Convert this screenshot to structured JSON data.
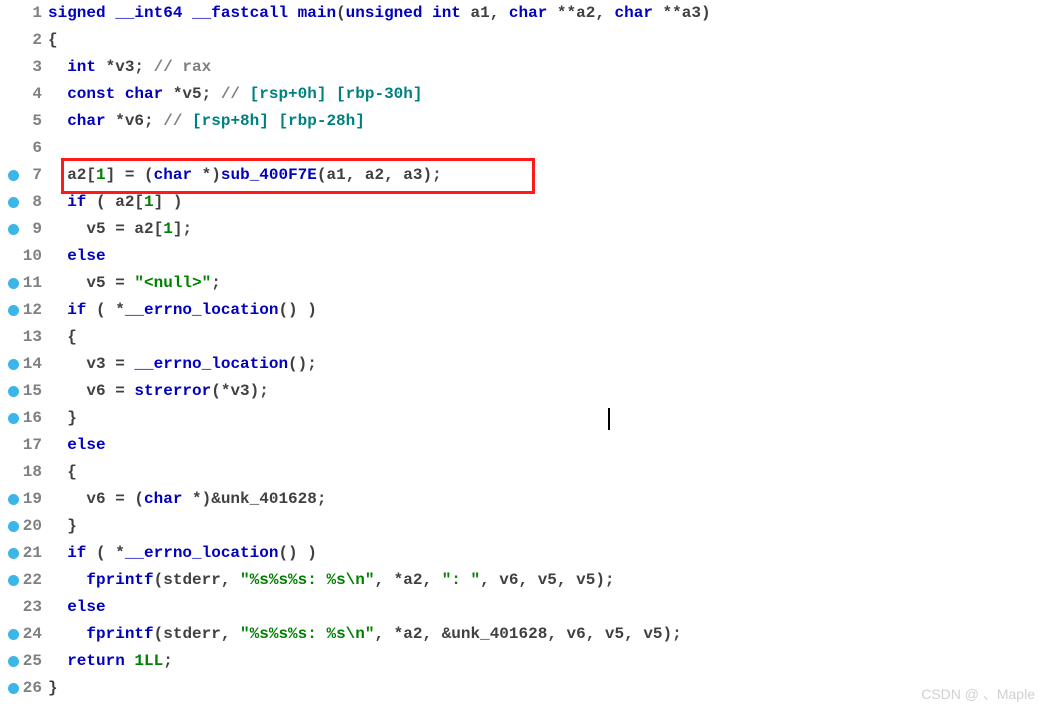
{
  "watermark": "CSDN @ 、Maple",
  "lines": [
    {
      "n": 1,
      "bp": false,
      "tokens": [
        [
          "kw",
          "signed "
        ],
        [
          "kw",
          "__int64 "
        ],
        [
          "type",
          "__fastcall "
        ],
        [
          "func",
          "main"
        ],
        [
          "op",
          "("
        ],
        [
          "kw",
          "unsigned int"
        ],
        [
          "var",
          " a1"
        ],
        [
          "op",
          ", "
        ],
        [
          "kw",
          "char"
        ],
        [
          "op",
          " **"
        ],
        [
          "var",
          "a2"
        ],
        [
          "op",
          ", "
        ],
        [
          "kw",
          "char"
        ],
        [
          "op",
          " **"
        ],
        [
          "var",
          "a3"
        ],
        [
          "op",
          ")"
        ]
      ]
    },
    {
      "n": 2,
      "bp": false,
      "tokens": [
        [
          "op",
          "{"
        ]
      ]
    },
    {
      "n": 3,
      "bp": false,
      "tokens": [
        [
          "txt",
          "  "
        ],
        [
          "kw",
          "int"
        ],
        [
          "op",
          " *"
        ],
        [
          "var",
          "v3"
        ],
        [
          "op",
          "; "
        ],
        [
          "comment",
          "// rax"
        ]
      ]
    },
    {
      "n": 4,
      "bp": false,
      "tokens": [
        [
          "txt",
          "  "
        ],
        [
          "kw",
          "const char"
        ],
        [
          "op",
          " *"
        ],
        [
          "var",
          "v5"
        ],
        [
          "op",
          "; "
        ],
        [
          "comment",
          "// "
        ],
        [
          "comment2",
          "[rsp+0h] [rbp-30h]"
        ]
      ]
    },
    {
      "n": 5,
      "bp": false,
      "tokens": [
        [
          "txt",
          "  "
        ],
        [
          "kw",
          "char"
        ],
        [
          "op",
          " *"
        ],
        [
          "var",
          "v6"
        ],
        [
          "op",
          "; "
        ],
        [
          "comment",
          "// "
        ],
        [
          "comment2",
          "[rsp+8h] [rbp-28h]"
        ]
      ]
    },
    {
      "n": 6,
      "bp": false,
      "tokens": [
        [
          "txt",
          " "
        ]
      ]
    },
    {
      "n": 7,
      "bp": true,
      "tokens": [
        [
          "txt",
          "  "
        ],
        [
          "var",
          "a2"
        ],
        [
          "op",
          "["
        ],
        [
          "num",
          "1"
        ],
        [
          "op",
          "] = ("
        ],
        [
          "kw",
          "char"
        ],
        [
          "op",
          " *)"
        ],
        [
          "func",
          "sub_400F7E"
        ],
        [
          "op",
          "("
        ],
        [
          "var",
          "a1"
        ],
        [
          "op",
          ", "
        ],
        [
          "var",
          "a2"
        ],
        [
          "op",
          ", "
        ],
        [
          "var",
          "a3"
        ],
        [
          "op",
          ");"
        ]
      ]
    },
    {
      "n": 8,
      "bp": true,
      "tokens": [
        [
          "txt",
          "  "
        ],
        [
          "kw",
          "if"
        ],
        [
          "op",
          " ( "
        ],
        [
          "var",
          "a2"
        ],
        [
          "op",
          "["
        ],
        [
          "num",
          "1"
        ],
        [
          "op",
          "] )"
        ]
      ]
    },
    {
      "n": 9,
      "bp": true,
      "tokens": [
        [
          "txt",
          "    "
        ],
        [
          "var",
          "v5"
        ],
        [
          "op",
          " = "
        ],
        [
          "var",
          "a2"
        ],
        [
          "op",
          "["
        ],
        [
          "num",
          "1"
        ],
        [
          "op",
          "];"
        ]
      ]
    },
    {
      "n": 10,
      "bp": false,
      "tokens": [
        [
          "txt",
          "  "
        ],
        [
          "kw",
          "else"
        ]
      ]
    },
    {
      "n": 11,
      "bp": true,
      "tokens": [
        [
          "txt",
          "    "
        ],
        [
          "var",
          "v5"
        ],
        [
          "op",
          " = "
        ],
        [
          "str",
          "\"<null>\""
        ],
        [
          "op",
          ";"
        ]
      ]
    },
    {
      "n": 12,
      "bp": true,
      "tokens": [
        [
          "txt",
          "  "
        ],
        [
          "kw",
          "if"
        ],
        [
          "op",
          " ( *"
        ],
        [
          "func",
          "__errno_location"
        ],
        [
          "op",
          "() )"
        ]
      ]
    },
    {
      "n": 13,
      "bp": false,
      "tokens": [
        [
          "txt",
          "  "
        ],
        [
          "op",
          "{"
        ]
      ]
    },
    {
      "n": 14,
      "bp": true,
      "tokens": [
        [
          "txt",
          "    "
        ],
        [
          "var",
          "v3"
        ],
        [
          "op",
          " = "
        ],
        [
          "func",
          "__errno_location"
        ],
        [
          "op",
          "();"
        ]
      ]
    },
    {
      "n": 15,
      "bp": true,
      "tokens": [
        [
          "txt",
          "    "
        ],
        [
          "var",
          "v6"
        ],
        [
          "op",
          " = "
        ],
        [
          "func",
          "strerror"
        ],
        [
          "op",
          "(*"
        ],
        [
          "var",
          "v3"
        ],
        [
          "op",
          ");"
        ]
      ]
    },
    {
      "n": 16,
      "bp": true,
      "tokens": [
        [
          "txt",
          "  "
        ],
        [
          "op",
          "}"
        ]
      ]
    },
    {
      "n": 17,
      "bp": false,
      "tokens": [
        [
          "txt",
          "  "
        ],
        [
          "kw",
          "else"
        ]
      ]
    },
    {
      "n": 18,
      "bp": false,
      "tokens": [
        [
          "txt",
          "  "
        ],
        [
          "op",
          "{"
        ]
      ]
    },
    {
      "n": 19,
      "bp": true,
      "tokens": [
        [
          "txt",
          "    "
        ],
        [
          "var",
          "v6"
        ],
        [
          "op",
          " = ("
        ],
        [
          "kw",
          "char"
        ],
        [
          "op",
          " *)&"
        ],
        [
          "var",
          "unk_401628"
        ],
        [
          "op",
          ";"
        ]
      ]
    },
    {
      "n": 20,
      "bp": true,
      "tokens": [
        [
          "txt",
          "  "
        ],
        [
          "op",
          "}"
        ]
      ]
    },
    {
      "n": 21,
      "bp": true,
      "tokens": [
        [
          "txt",
          "  "
        ],
        [
          "kw",
          "if"
        ],
        [
          "op",
          " ( *"
        ],
        [
          "func",
          "__errno_location"
        ],
        [
          "op",
          "() )"
        ]
      ]
    },
    {
      "n": 22,
      "bp": true,
      "tokens": [
        [
          "txt",
          "    "
        ],
        [
          "func",
          "fprintf"
        ],
        [
          "op",
          "("
        ],
        [
          "var",
          "stderr"
        ],
        [
          "op",
          ", "
        ],
        [
          "str",
          "\"%s%s%s: %s\\n\""
        ],
        [
          "op",
          ", *"
        ],
        [
          "var",
          "a2"
        ],
        [
          "op",
          ", "
        ],
        [
          "str",
          "\": \""
        ],
        [
          "op",
          ", "
        ],
        [
          "var",
          "v6"
        ],
        [
          "op",
          ", "
        ],
        [
          "var",
          "v5"
        ],
        [
          "op",
          ", "
        ],
        [
          "var",
          "v5"
        ],
        [
          "op",
          ");"
        ]
      ]
    },
    {
      "n": 23,
      "bp": false,
      "tokens": [
        [
          "txt",
          "  "
        ],
        [
          "kw",
          "else"
        ]
      ]
    },
    {
      "n": 24,
      "bp": true,
      "tokens": [
        [
          "txt",
          "    "
        ],
        [
          "func",
          "fprintf"
        ],
        [
          "op",
          "("
        ],
        [
          "var",
          "stderr"
        ],
        [
          "op",
          ", "
        ],
        [
          "str",
          "\"%s%s%s: %s\\n\""
        ],
        [
          "op",
          ", *"
        ],
        [
          "var",
          "a2"
        ],
        [
          "op",
          ", &"
        ],
        [
          "var",
          "unk_401628"
        ],
        [
          "op",
          ", "
        ],
        [
          "var",
          "v6"
        ],
        [
          "op",
          ", "
        ],
        [
          "var",
          "v5"
        ],
        [
          "op",
          ", "
        ],
        [
          "var",
          "v5"
        ],
        [
          "op",
          ");"
        ]
      ]
    },
    {
      "n": 25,
      "bp": true,
      "tokens": [
        [
          "txt",
          "  "
        ],
        [
          "kw",
          "return"
        ],
        [
          "op",
          " "
        ],
        [
          "num",
          "1LL"
        ],
        [
          "op",
          ";"
        ]
      ]
    },
    {
      "n": 26,
      "bp": true,
      "tokens": [
        [
          "op",
          "}"
        ]
      ]
    }
  ]
}
